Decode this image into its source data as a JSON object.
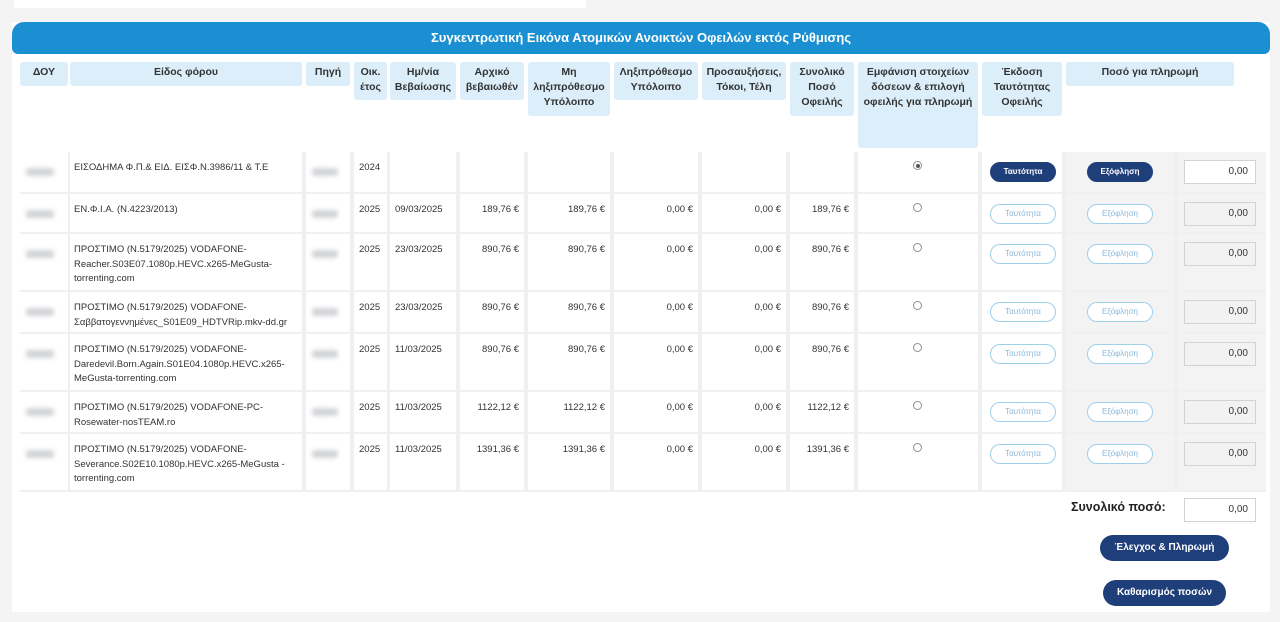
{
  "page_title": "Συγκεντρωτική Εικόνα Ατομικών Ανοικτών Οφειλών εκτός Ρύθμισης",
  "headers": {
    "doy": "ΔΟΥ",
    "eidos": "Είδος φόρου",
    "pigi": "Πηγή",
    "etos": "Οικ. έτος",
    "imnia": "Ημ/νία Βεβαίωσης",
    "arxiko": "Αρχικό βεβαιωθέν",
    "mi_lixi": "Μη ληξιπρόθεσμο Υπόλοιπο",
    "lixi": "Ληξιπρόθεσμο Υπόλοιπο",
    "prosaux": "Προσαυξήσεις, Τόκοι, Τέλη",
    "synoliko": "Συνολικό Ποσό Οφειλής",
    "emfanisi": "Εμφάνιση στοιχείων δόσεων & επιλογή οφειλής για πληρωμή",
    "ekdosi": "Έκδοση Ταυτότητας Οφειλής",
    "poso": "Ποσό για πληρωμή"
  },
  "rows": [
    {
      "eidos": "ΕΙΣΟΔΗΜΑ Φ.Π.& ΕΙΔ. ΕΙΣΦ.Ν.3986/11 & Τ.Ε",
      "etos": "2024",
      "date": "",
      "arxiko": "",
      "mi": "",
      "lixi": "",
      "pros": "",
      "syn": "",
      "selected": true,
      "active": true,
      "amount": "0,00"
    },
    {
      "eidos": "ΕΝ.Φ.Ι.Α. (Ν.4223/2013)",
      "etos": "2025",
      "date": "09/03/2025",
      "arxiko": "189,76 €",
      "mi": "189,76 €",
      "lixi": "0,00 €",
      "pros": "0,00 €",
      "syn": "189,76 €",
      "selected": false,
      "active": false,
      "amount": "0,00"
    },
    {
      "eidos": "ΠΡΟΣΤΙΜΟ (Ν.5179/2025) VODAFONE-Reacher.S03E07.1080p.HEVC.x265-MeGusta-torrenting.com",
      "etos": "2025",
      "date": "23/03/2025",
      "arxiko": "890,76 €",
      "mi": "890,76 €",
      "lixi": "0,00 €",
      "pros": "0,00 €",
      "syn": "890,76 €",
      "selected": false,
      "active": false,
      "amount": "0,00"
    },
    {
      "eidos": "ΠΡΟΣΤΙΜΟ (Ν.5179/2025) VODAFONE-Σαββατογεννημένες_S01E09_HDTVRip.mkv-dd.gr",
      "etos": "2025",
      "date": "23/03/2025",
      "arxiko": "890,76 €",
      "mi": "890,76 €",
      "lixi": "0,00 €",
      "pros": "0,00 €",
      "syn": "890,76 €",
      "selected": false,
      "active": false,
      "amount": "0,00"
    },
    {
      "eidos": "ΠΡΟΣΤΙΜΟ (Ν.5179/2025) VODAFONE-Daredevil.Born.Again.S01E04.1080p.HEVC.x265-MeGusta-torrenting.com",
      "etos": "2025",
      "date": "11/03/2025",
      "arxiko": "890,76 €",
      "mi": "890,76 €",
      "lixi": "0,00 €",
      "pros": "0,00 €",
      "syn": "890,76 €",
      "selected": false,
      "active": false,
      "amount": "0,00"
    },
    {
      "eidos": "ΠΡΟΣΤΙΜΟ (Ν.5179/2025) VODAFONE-PC-Rosewater-nosTEAM.ro",
      "etos": "2025",
      "date": "11/03/2025",
      "arxiko": "1122,12 €",
      "mi": "1122,12 €",
      "lixi": "0,00 €",
      "pros": "0,00 €",
      "syn": "1122,12 €",
      "selected": false,
      "active": false,
      "amount": "0,00"
    },
    {
      "eidos": "ΠΡΟΣΤΙΜΟ (Ν.5179/2025) VODAFONE-Severance.S02E10.1080p.HEVC.x265-MeGusta - torrenting.com",
      "etos": "2025",
      "date": "11/03/2025",
      "arxiko": "1391,36 €",
      "mi": "1391,36 €",
      "lixi": "0,00 €",
      "pros": "0,00 €",
      "syn": "1391,36 €",
      "selected": false,
      "active": false,
      "amount": "0,00"
    }
  ],
  "row_buttons": {
    "identity": "Ταυτότητα",
    "pay": "Εξόφληση"
  },
  "total": {
    "label": "Συνολικό ποσό:",
    "value": "0,00"
  },
  "actions": {
    "check_pay": "Έλεγχος & Πληρωμή",
    "clear": "Καθαρισμός ποσών"
  },
  "colors": {
    "banner": "#1a8fd1",
    "header_cell": "#dceef9",
    "button_dark": "#1f3f7a",
    "button_light_border": "#9ed0ea"
  }
}
